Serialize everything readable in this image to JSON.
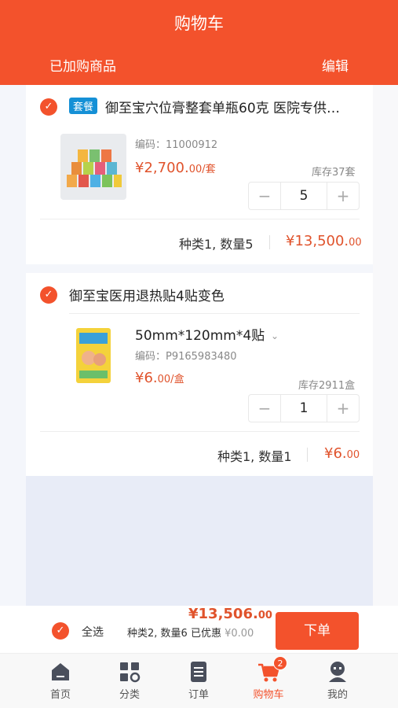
{
  "header": {
    "title": "购物车",
    "subtitle": "已加购商品",
    "edit_label": "编辑"
  },
  "colors": {
    "accent": "#f3522c",
    "price": "#e0532c",
    "tag": "#1590d6"
  },
  "items": [
    {
      "tag": "套餐",
      "name": "御至宝穴位膏整套单瓶60克 医院专供…",
      "code": "编码：11000912",
      "price": "¥2,700.",
      "price_small": "00/套",
      "stock": "库存37套",
      "quantity": "5",
      "summary": "种类1, 数量5",
      "subtotal": "¥13,500.",
      "subtotal_small": "00"
    },
    {
      "name": "御至宝医用退热贴4贴变色",
      "spec": "50mm*120mm*4贴",
      "code": "编码：P9165983480",
      "price": "¥6.",
      "price_small": "00/盒",
      "stock": "库存2911盒",
      "quantity": "1",
      "summary": "种类1, 数量1",
      "subtotal": "¥6.",
      "subtotal_small": "00"
    }
  ],
  "stepper": {
    "minus": "−",
    "plus": "+"
  },
  "bottom": {
    "select_all": "全选",
    "total": "¥13,506.",
    "total_small": "00",
    "summary": "种类2, 数量6 已优惠",
    "discount": "¥0.00",
    "order_button": "下单"
  },
  "tabs": [
    {
      "label": "首页",
      "icon": "home-icon"
    },
    {
      "label": "分类",
      "icon": "category-icon"
    },
    {
      "label": "订单",
      "icon": "order-icon"
    },
    {
      "label": "购物车",
      "icon": "cart-icon",
      "badge": "2",
      "active": true
    },
    {
      "label": "我的",
      "icon": "profile-icon"
    }
  ]
}
